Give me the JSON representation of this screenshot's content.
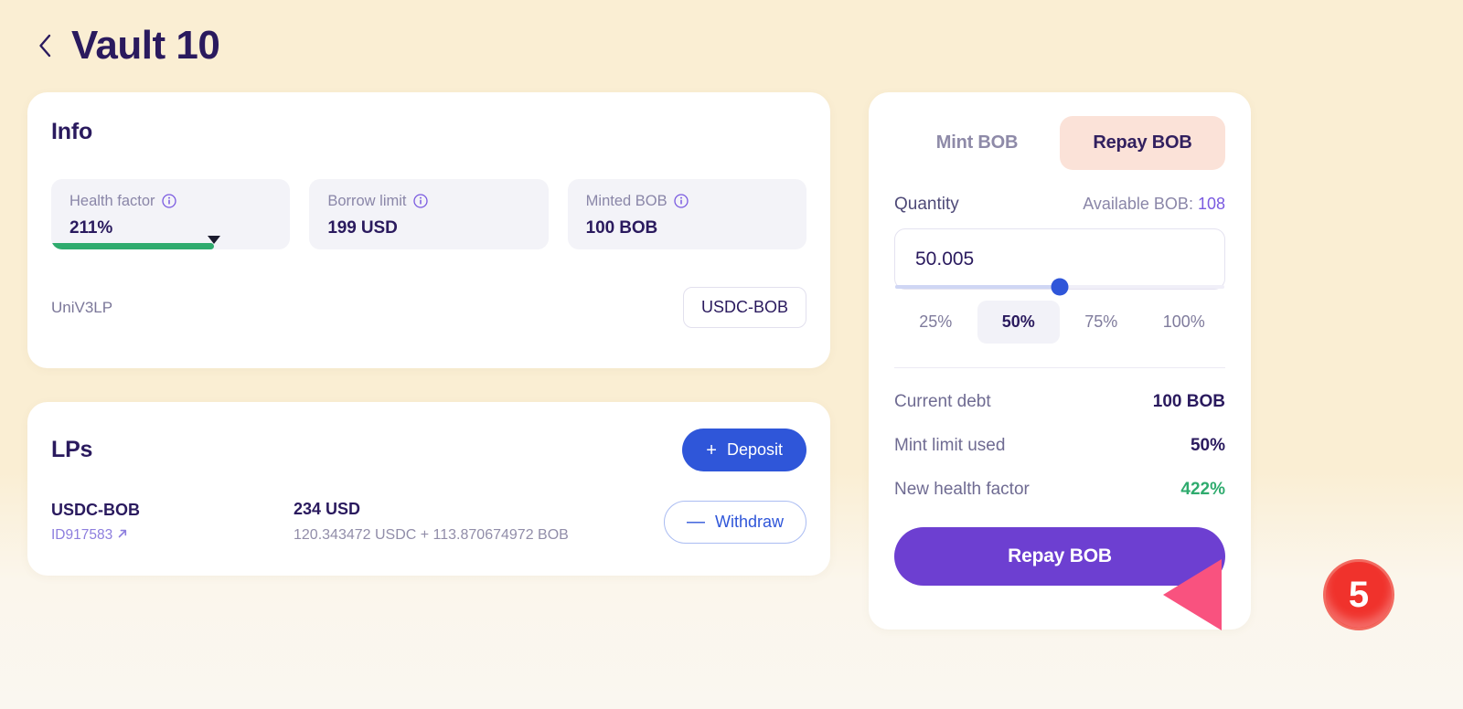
{
  "header": {
    "back_icon": "chevron-left-icon",
    "title": "Vault 10"
  },
  "info_card": {
    "title": "Info",
    "stats": [
      {
        "label": "Health factor",
        "value": "211%",
        "info_icon": "info-icon",
        "bar_percent": 68
      },
      {
        "label": "Borrow limit",
        "value": "199 USD",
        "info_icon": "info-icon"
      },
      {
        "label": "Minted BOB",
        "value": "100 BOB",
        "info_icon": "info-icon"
      }
    ],
    "protocol": "UniV3LP",
    "pair_pill": "USDC-BOB"
  },
  "lps_card": {
    "title": "LPs",
    "deposit_button": "Deposit",
    "deposit_sign": "+",
    "withdraw_button": "Withdraw",
    "withdraw_sign": "—",
    "row": {
      "pair": "USDC-BOB",
      "id": "ID917583",
      "id_icon": "external-link-icon",
      "usd_value": "234 USD",
      "breakdown": "120.343472 USDC + 113.870674972 BOB"
    }
  },
  "panel": {
    "tabs": [
      {
        "label": "Mint BOB",
        "active": false
      },
      {
        "label": "Repay BOB",
        "active": true
      }
    ],
    "quantity_label": "Quantity",
    "available_prefix": "Available BOB: ",
    "available_value": "108",
    "amount_value": "50.005",
    "amount_placeholder": "0.0",
    "slider_percent": 50,
    "percent_options": [
      {
        "label": "25%",
        "active": false
      },
      {
        "label": "50%",
        "active": true
      },
      {
        "label": "75%",
        "active": false
      },
      {
        "label": "100%",
        "active": false
      }
    ],
    "summary": [
      {
        "label": "Current debt",
        "value": "100 BOB",
        "tone": "normal"
      },
      {
        "label": "Mint limit used",
        "value": "50%",
        "tone": "normal"
      },
      {
        "label": "New health factor",
        "value": "422%",
        "tone": "green"
      }
    ],
    "submit_button": "Repay BOB"
  },
  "annotation": {
    "step_number": "5",
    "arrow_color": "#f9527f",
    "badge_color": "#f0322c"
  },
  "colors": {
    "background": "#faeed3",
    "accent_purple": "#6d3fd1",
    "accent_blue": "#2f56d9",
    "green": "#2fab6e",
    "tab_active_bg": "#fbe2d8",
    "text_dark": "#2a1a5e",
    "text_muted": "#8a86a8"
  }
}
